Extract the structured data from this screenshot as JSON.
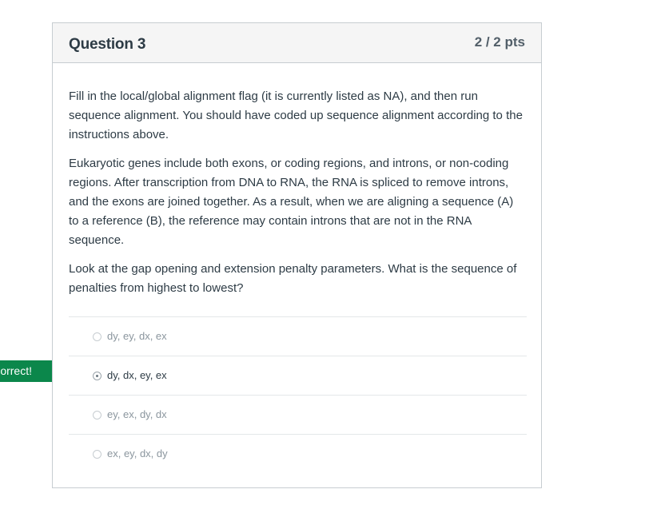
{
  "question": {
    "title": "Question 3",
    "points": "2 / 2 pts",
    "paragraphs": [
      "Fill in the local/global alignment flag (it is currently listed as NA), and then run sequence alignment. You should have coded up sequence alignment according to the instructions above.",
      "Eukaryotic genes include both exons, or coding regions, and introns, or non-coding regions. After transcription from DNA to RNA, the RNA is spliced to remove introns, and the exons are joined together. As a result, when we are aligning a sequence (A) to a reference (B), the reference may contain introns that are not in the RNA sequence.",
      "Look at the gap opening and extension penalty parameters. What is the sequence of penalties from highest to lowest?"
    ],
    "answers": [
      {
        "label": "dy, ey, dx, ex",
        "selected": false
      },
      {
        "label": "dy, dx, ey, ex",
        "selected": true
      },
      {
        "label": "ey, ex, dy, dx",
        "selected": false
      },
      {
        "label": "ex, ey, dx, dy",
        "selected": false
      }
    ]
  },
  "flag": {
    "text": "Correct!",
    "color": "#0b874b"
  }
}
